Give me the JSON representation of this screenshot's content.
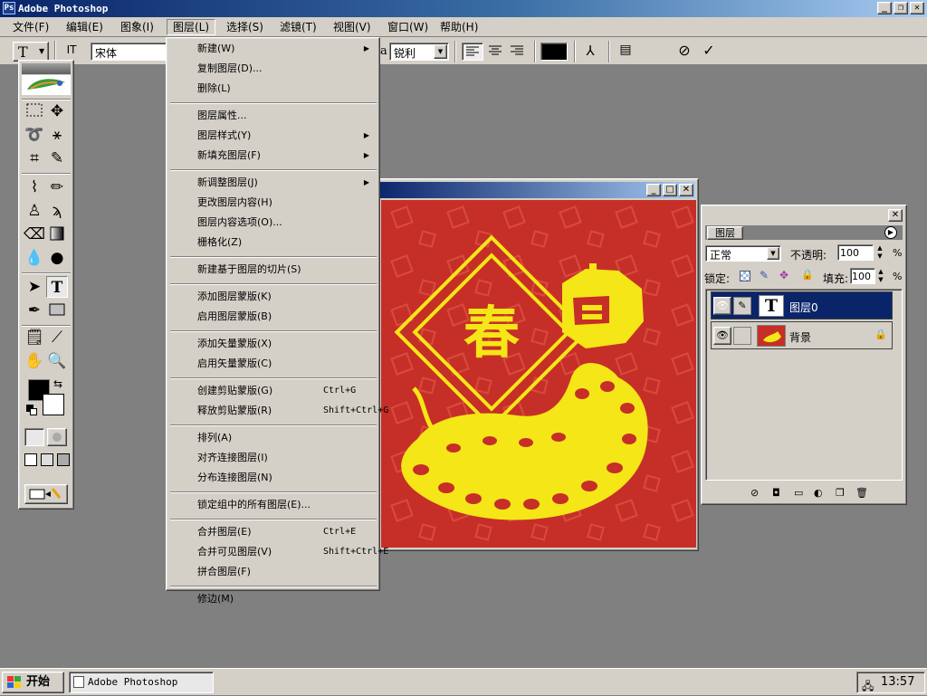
{
  "app": {
    "title": "Adobe Photoshop"
  },
  "window_controls": {
    "minimize": "_",
    "restore": "❐",
    "close": "✕"
  },
  "menubar": [
    {
      "label": "文件(F)"
    },
    {
      "label": "编辑(E)"
    },
    {
      "label": "图象(I)"
    },
    {
      "label": "图层(L)"
    },
    {
      "label": "选择(S)"
    },
    {
      "label": "滤镜(T)"
    },
    {
      "label": "视图(V)"
    },
    {
      "label": "窗口(W)"
    },
    {
      "label": "帮助(H)"
    }
  ],
  "options_bar": {
    "font_family": "宋体",
    "aa_prefix": "a",
    "antialias": "锐利",
    "text_tool_glyph": "T",
    "orient_glyph": "IT"
  },
  "layer_menu": {
    "items": [
      {
        "label": "新建(W)",
        "shortcut": "",
        "submenu": true
      },
      {
        "label": "复制图层(D)...",
        "shortcut": "",
        "submenu": false
      },
      {
        "label": "删除(L)",
        "shortcut": "",
        "submenu": false
      },
      {
        "label": "图层属性...",
        "shortcut": "",
        "submenu": false
      },
      {
        "label": "图层样式(Y)",
        "shortcut": "",
        "submenu": true
      },
      {
        "label": "新填充图层(F)",
        "shortcut": "",
        "submenu": true
      },
      {
        "label": "新调整图层(J)",
        "shortcut": "",
        "submenu": true
      },
      {
        "label": "更改图层内容(H)",
        "shortcut": "",
        "submenu": false
      },
      {
        "label": "图层内容选项(O)...",
        "shortcut": "",
        "submenu": false
      },
      {
        "label": "栅格化(Z)",
        "shortcut": "",
        "submenu": false
      },
      {
        "label": "新建基于图层的切片(S)",
        "shortcut": "",
        "submenu": false
      },
      {
        "label": "添加图层蒙版(K)",
        "shortcut": "",
        "submenu": false
      },
      {
        "label": "启用图层蒙版(B)",
        "shortcut": "",
        "submenu": false
      },
      {
        "label": "添加矢量蒙版(X)",
        "shortcut": "",
        "submenu": false
      },
      {
        "label": "启用矢量蒙版(C)",
        "shortcut": "",
        "submenu": false
      },
      {
        "label": "创建剪贴蒙版(G)",
        "shortcut": "Ctrl+G",
        "submenu": false
      },
      {
        "label": "释放剪贴蒙版(R)",
        "shortcut": "Shift+Ctrl+G",
        "submenu": false
      },
      {
        "label": "排列(A)",
        "shortcut": "",
        "submenu": false
      },
      {
        "label": "对齐连接图层(I)",
        "shortcut": "",
        "submenu": false
      },
      {
        "label": "分布连接图层(N)",
        "shortcut": "",
        "submenu": false
      },
      {
        "label": "锁定组中的所有图层(E)...",
        "shortcut": "",
        "submenu": false
      },
      {
        "label": "合并图层(E)",
        "shortcut": "Ctrl+E",
        "submenu": false
      },
      {
        "label": "合并可见图层(V)",
        "shortcut": "Shift+Ctrl+E",
        "submenu": false
      },
      {
        "label": "拼合图层(F)",
        "shortcut": "",
        "submenu": false
      },
      {
        "label": "修边(M)",
        "shortcut": "",
        "submenu": false
      }
    ]
  },
  "document": {
    "canvas_color": "#c62f27",
    "art_color": "#f5e617",
    "motif": "春"
  },
  "layers_panel": {
    "tab": "图层",
    "blend_mode": "正常",
    "opacity_label": "不透明:",
    "opacity_value": "100",
    "lock_label": "锁定:",
    "fill_label": "填充:",
    "fill_value": "100",
    "percent": "%",
    "layers": [
      {
        "name": "图层0",
        "thumb": "T",
        "selected": true
      },
      {
        "name": "背景",
        "thumb": "",
        "selected": false
      }
    ]
  },
  "taskbar": {
    "start": "开始",
    "task": "Adobe Photoshop",
    "time": "13:57"
  },
  "colors": {
    "titlebar": "#0a246a",
    "chrome": "#d4d0c8",
    "selection": "#0a246a"
  }
}
